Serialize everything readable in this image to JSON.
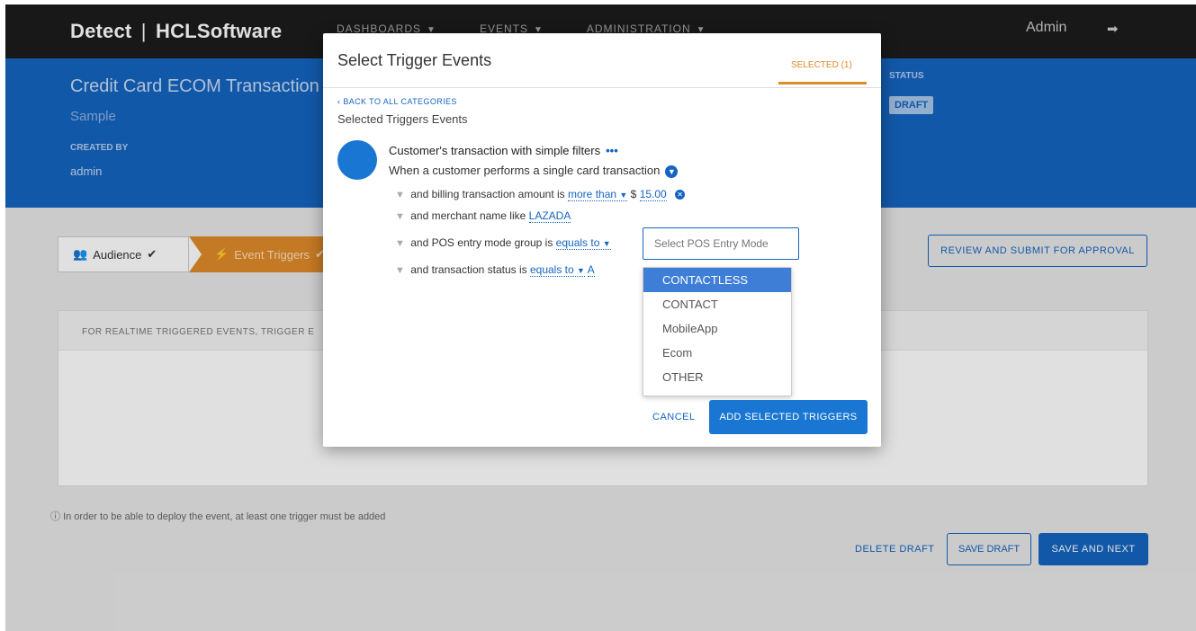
{
  "topnav": {
    "brand_bold": "Detect",
    "brand_sep": "|",
    "brand_name": "HCLSoftware",
    "menu": [
      {
        "label": "DASHBOARDS"
      },
      {
        "label": "EVENTS"
      },
      {
        "label": "ADMINISTRATION"
      }
    ],
    "user": "Admin"
  },
  "header": {
    "title": "Credit Card ECOM Transaction",
    "subtitle": "Sample",
    "created_by_label": "CREATED BY",
    "created_by": "admin",
    "status_label": "STATUS",
    "status": "DRAFT"
  },
  "steps": {
    "audience": "Audience",
    "event_triggers": "Event Triggers"
  },
  "review_button": "REVIEW AND SUBMIT FOR APPROVAL",
  "panel": {
    "header": "FOR REALTIME TRIGGERED EVENTS, TRIGGER E"
  },
  "info_text": "In order to be able to deploy the event, at least one trigger must be added",
  "footer": {
    "delete": "DELETE DRAFT",
    "save_draft": "SAVE DRAFT",
    "save_next": "SAVE AND NEXT"
  },
  "modal": {
    "title": "Select Trigger Events",
    "selected_tab": "SELECTED (1)",
    "back": "BACK TO ALL CATEGORIES",
    "selected_label": "Selected Triggers Events",
    "trigger": {
      "name": "Customer's transaction with simple filters",
      "description": "When a customer performs a single card transaction",
      "conditions": {
        "amount": {
          "text": "and billing transaction amount is",
          "op": "more than",
          "currency": "$",
          "value": "15.00"
        },
        "merchant": {
          "text": "and merchant name like",
          "value": "LAZADA"
        },
        "pos": {
          "text": "and POS entry mode group is",
          "op": "equals to",
          "placeholder": "Select POS Entry Mode"
        },
        "status": {
          "text": "and transaction status is",
          "op": "equals to",
          "value": "A"
        }
      }
    },
    "pos_options": [
      "CONTACTLESS",
      "CONTACT",
      "MobileApp",
      "Ecom",
      "OTHER"
    ],
    "cancel": "CANCEL",
    "add": "ADD SELECTED TRIGGERS"
  }
}
